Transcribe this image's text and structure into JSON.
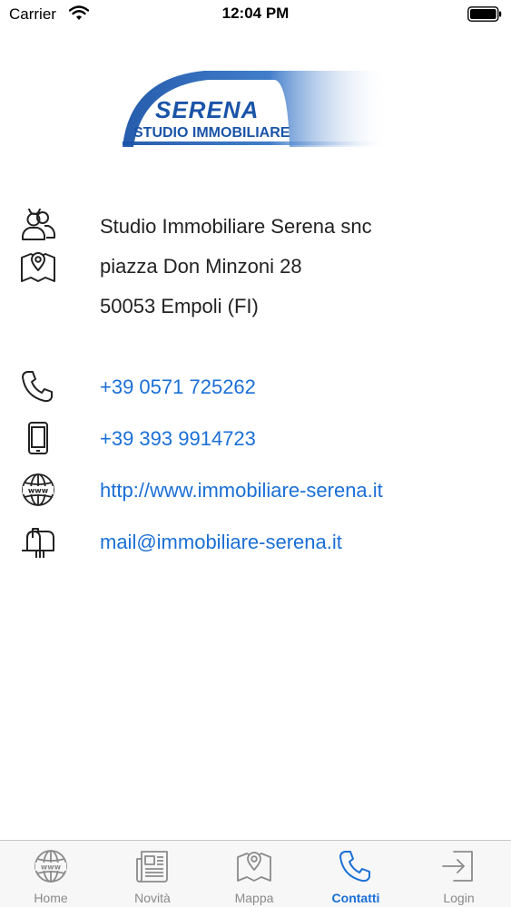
{
  "status_bar": {
    "carrier": "Carrier",
    "time": "12:04 PM"
  },
  "logo": {
    "main": "SERENA",
    "sub": "STUDIO IMMOBILIARE"
  },
  "contact": {
    "company": "Studio Immobiliare Serena snc",
    "street": "piazza Don Minzoni 28",
    "city": "50053 Empoli (FI)",
    "phone": "+39 0571 725262",
    "mobile": "+39 393 9914723",
    "website": "http://www.immobiliare-serena.it",
    "email": "mail@immobiliare-serena.it"
  },
  "tabs": [
    {
      "label": "Home",
      "icon": "globe-icon"
    },
    {
      "label": "Novità",
      "icon": "newspaper-icon"
    },
    {
      "label": "Mappa",
      "icon": "map-icon"
    },
    {
      "label": "Contatti",
      "icon": "phone-icon"
    },
    {
      "label": "Login",
      "icon": "login-icon"
    }
  ],
  "colors": {
    "accent": "#1a6fd6",
    "brand": "#1a54a8",
    "tab_inactive": "#8a8a8a"
  }
}
